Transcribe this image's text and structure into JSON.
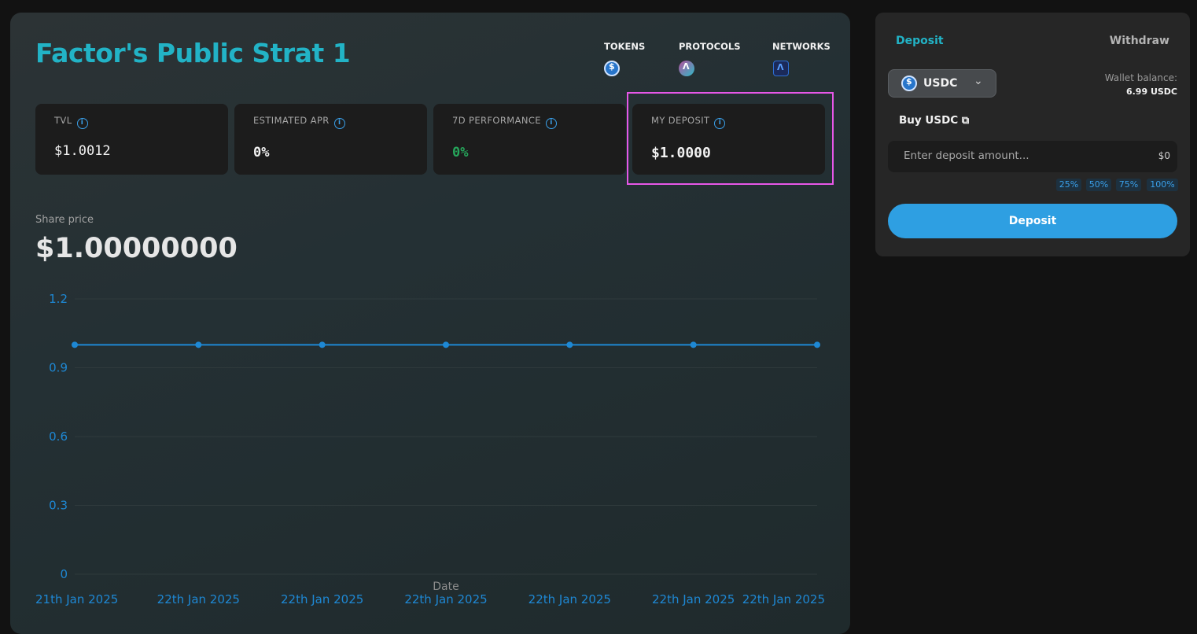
{
  "strategy": {
    "title": "Factor's Public Strat 1",
    "meta": [
      {
        "label": "TOKENS",
        "icon": "usdc-token-icon"
      },
      {
        "label": "PROTOCOLS",
        "icon": "aave-protocol-icon"
      },
      {
        "label": "NETWORKS",
        "icon": "arbitrum-network-icon"
      }
    ],
    "stats": [
      {
        "label": "TVL",
        "value": "$1.0012",
        "color": "#f2f2f2"
      },
      {
        "label": "ESTIMATED APR",
        "value": "0%",
        "color": "#f2f2f2"
      },
      {
        "label": "7D PERFORMANCE",
        "value": "0%",
        "color": "#26a65b"
      },
      {
        "label": "MY DEPOSIT",
        "value": "$1.0000",
        "color": "#f2f2f2"
      }
    ],
    "share_price_label": "Share price",
    "share_price_value": "$1.00000000"
  },
  "chart_data": {
    "type": "line",
    "xlabel": "Date",
    "ylabel": "",
    "ylim": [
      0,
      1.2
    ],
    "yticks": [
      "1.2",
      "0.9",
      "0.6",
      "0.3",
      "0"
    ],
    "x": [
      "21th Jan 2025",
      "22th Jan 2025",
      "22th Jan 2025",
      "22th Jan 2025",
      "22th Jan 2025",
      "22th Jan 2025",
      "22th Jan 2025"
    ],
    "values": [
      1,
      1,
      1,
      1,
      1,
      1,
      1
    ],
    "line_color": "#1e88d4",
    "grid": true
  },
  "panel": {
    "tab_deposit": "Deposit",
    "tab_withdraw": "Withdraw",
    "asset": "USDC",
    "wallet_balance_label": "Wallet balance:",
    "wallet_balance_value": "6.99 USDC",
    "buy_link": "Buy USDC",
    "input_placeholder": "Enter deposit amount...",
    "input_usd_value": "$0",
    "percent_options": [
      "25%",
      "50%",
      "75%",
      "100%"
    ],
    "deposit_button": "Deposit"
  }
}
